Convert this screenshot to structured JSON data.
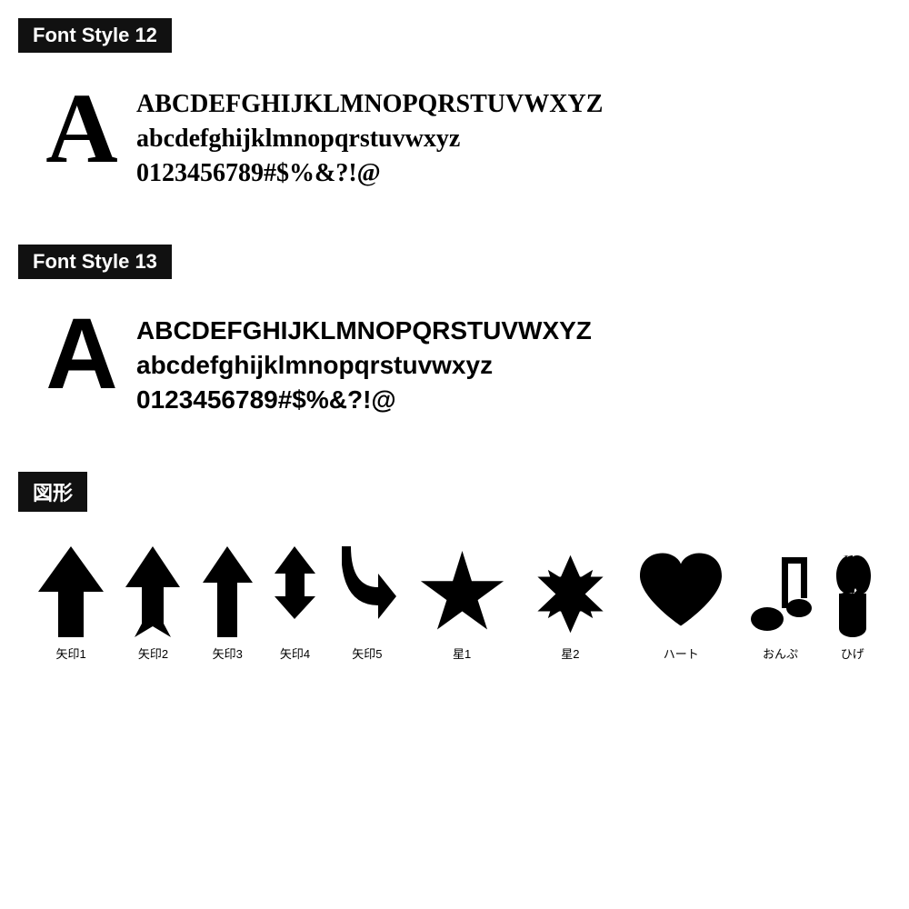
{
  "sections": [
    {
      "id": "font-style-12",
      "label": "Font Style 12",
      "bigLetter": "A",
      "lines": [
        "ABCDEFGHIJKLMNOPQRSTUVWXYZ",
        "abcdefghijklmnopqrstuvwxyz",
        "0123456789#$%&?!@"
      ],
      "style": "serif"
    },
    {
      "id": "font-style-13",
      "label": "Font Style 13",
      "bigLetter": "A",
      "lines": [
        "ABCDEFGHIJKLMNOPQRSTUVWXYZ",
        "abcdefghijklmnopqrstuvwxyz",
        "0123456789#$%&?!@"
      ],
      "style": "sans-serif"
    }
  ],
  "shapesSection": {
    "label": "図形",
    "shapes": [
      {
        "name": "矢印1",
        "icon": "arrow1"
      },
      {
        "name": "矢印2",
        "icon": "arrow2"
      },
      {
        "name": "矢印3",
        "icon": "arrow3"
      },
      {
        "name": "矢印4",
        "icon": "arrow4"
      },
      {
        "name": "矢印5",
        "icon": "arrow5"
      },
      {
        "name": "星1",
        "icon": "star1"
      },
      {
        "name": "星2",
        "icon": "star2"
      },
      {
        "name": "ハート",
        "icon": "heart"
      },
      {
        "name": "おんぷ",
        "icon": "music"
      },
      {
        "name": "ひげ",
        "icon": "mustache"
      }
    ]
  }
}
